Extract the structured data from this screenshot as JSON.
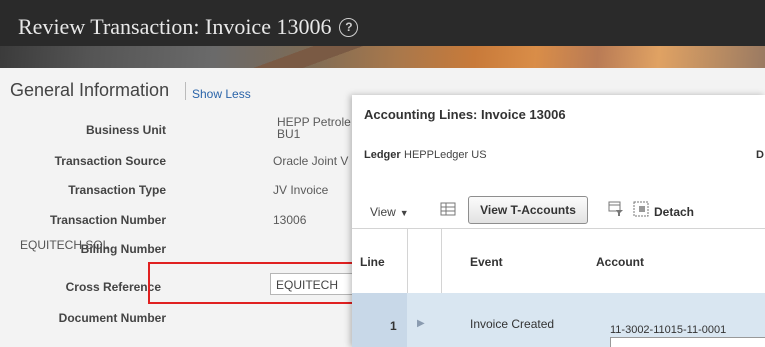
{
  "header": {
    "title": "Review Transaction: Invoice 13006",
    "help_icon": "question-circle-icon"
  },
  "general_info": {
    "title": "General Information",
    "show_less": "Show Less",
    "side_value": "EQUITECH SOL",
    "fields": {
      "business_unit": {
        "label": "Business Unit",
        "value_line1": "HEPP Petrole",
        "value_line2": "BU1"
      },
      "transaction_source": {
        "label": "Transaction Source",
        "value": "Oracle Joint V"
      },
      "transaction_type": {
        "label": "Transaction Type",
        "value": "JV Invoice"
      },
      "transaction_number": {
        "label": "Transaction Number",
        "value": "13006"
      },
      "billing_number": {
        "label": "Billing Number"
      },
      "cross_reference": {
        "label": "Cross Reference",
        "value": "EQUITECH"
      },
      "document_number": {
        "label": "Document Number"
      }
    }
  },
  "dialog": {
    "title": "Accounting Lines: Invoice 13006",
    "ledger_label": "Ledger",
    "ledger_value": "HEPPLedger US",
    "truncated_label": "D",
    "toolbar": {
      "view": "View",
      "view_tacc": "View T-Accounts",
      "detach": "Detach"
    },
    "table": {
      "columns": [
        "Line",
        "Event",
        "Account"
      ],
      "rows": [
        {
          "line": "1",
          "event": "Invoice Created",
          "account": "11-3002-11015-11-0001"
        }
      ]
    }
  },
  "colors": {
    "highlight": "#e02020",
    "link": "#2a64a9",
    "selected_row": "#d9e6f1"
  }
}
